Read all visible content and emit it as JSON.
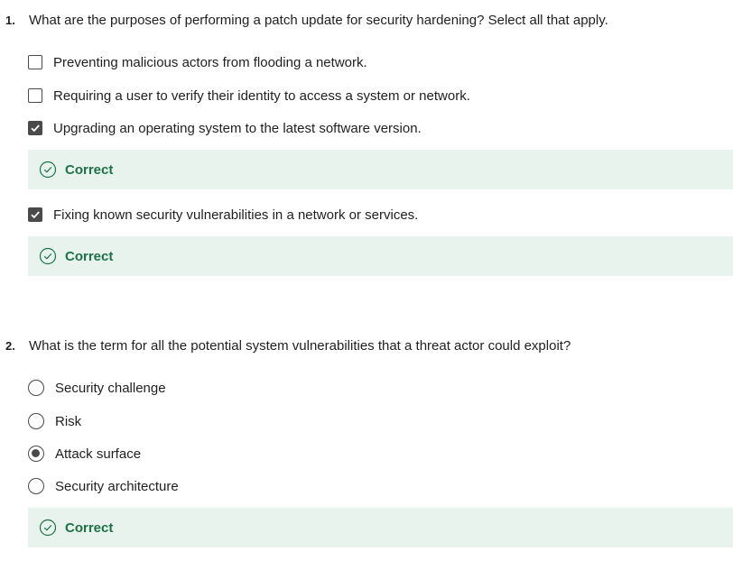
{
  "questions": [
    {
      "number": "1.",
      "text": "What are the purposes of performing a patch update for security hardening? Select all that apply.",
      "type": "checkbox",
      "options": [
        {
          "label": "Preventing malicious actors from flooding a network.",
          "checked": false
        },
        {
          "label": "Requiring a user to verify their identity to access a system or network.",
          "checked": false
        },
        {
          "label": "Upgrading an operating system to the latest software version.",
          "checked": true,
          "feedback": "Correct"
        },
        {
          "label": "Fixing known security vulnerabilities in a network or services.",
          "checked": true,
          "feedback": "Correct"
        }
      ]
    },
    {
      "number": "2.",
      "text": "What is the term for all the potential system vulnerabilities that a threat actor could exploit?",
      "type": "radio",
      "options": [
        {
          "label": "Security challenge",
          "checked": false
        },
        {
          "label": "Risk",
          "checked": false
        },
        {
          "label": "Attack surface",
          "checked": true
        },
        {
          "label": "Security architecture",
          "checked": false
        }
      ],
      "feedback": "Correct"
    }
  ],
  "colors": {
    "correct_text": "#1e7146",
    "feedback_bg": "#e8f3ee",
    "control": "#4a4a4a"
  }
}
